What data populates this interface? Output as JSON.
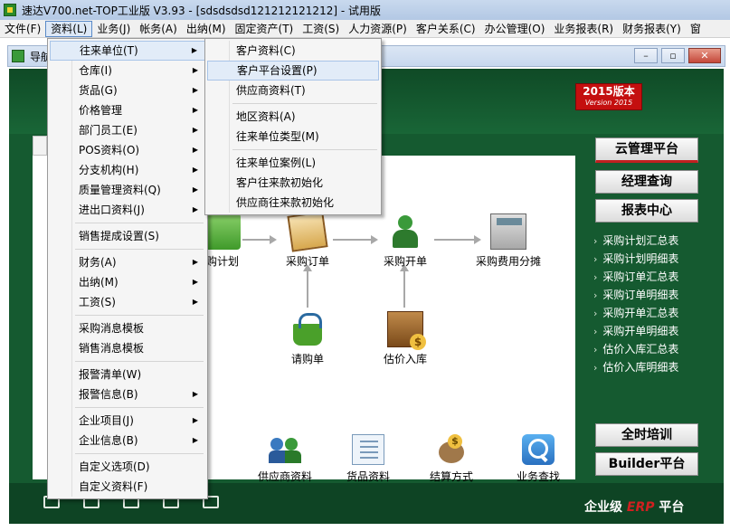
{
  "window": {
    "title": "速达V700.net-TOP工业版 V3.93 - [sdsdsdsd121212121212] - 试用版"
  },
  "menubar": [
    "文件(F)",
    "资料(L)",
    "业务(J)",
    "帐务(A)",
    "出纳(M)",
    "固定资产(T)",
    "工资(S)",
    "人力资源(P)",
    "客户关系(C)",
    "办公管理(O)",
    "业务报表(R)",
    "财务报表(Y)",
    "窗"
  ],
  "inner_window": {
    "title": "导航"
  },
  "version_badge": {
    "main": "2015版本",
    "sub": "Version 2015"
  },
  "menu_main": {
    "items": [
      {
        "label": "往来单位(T)",
        "sub": true
      },
      {
        "label": "仓库(I)",
        "sub": true
      },
      {
        "label": "货品(G)",
        "sub": true
      },
      {
        "label": "价格管理",
        "sub": true
      },
      {
        "label": "部门员工(E)",
        "sub": true
      },
      {
        "label": "POS资料(O)",
        "sub": true
      },
      {
        "label": "分支机构(H)",
        "sub": true
      },
      {
        "label": "质量管理资料(Q)",
        "sub": true
      },
      {
        "label": "进出口资料(J)",
        "sub": true
      },
      {
        "label": "销售提成设置(S)",
        "sub": false
      },
      {
        "label": "财务(A)",
        "sub": true
      },
      {
        "label": "出纳(M)",
        "sub": true
      },
      {
        "label": "工资(S)",
        "sub": true
      },
      {
        "label": "采购消息模板",
        "sub": false
      },
      {
        "label": "销售消息模板",
        "sub": false
      },
      {
        "label": "报警清单(W)",
        "sub": false
      },
      {
        "label": "报警信息(B)",
        "sub": true
      },
      {
        "label": "企业项目(J)",
        "sub": true
      },
      {
        "label": "企业信息(B)",
        "sub": true
      },
      {
        "label": "自定义选项(D)",
        "sub": false
      },
      {
        "label": "自定义资料(F)",
        "sub": false
      }
    ]
  },
  "menu_sub": {
    "items": [
      {
        "label": "客户资料(C)"
      },
      {
        "label": "客户平台设置(P)"
      },
      {
        "label": "供应商资料(T)"
      },
      {
        "label": "地区资料(A)"
      },
      {
        "label": "往来单位类型(M)"
      },
      {
        "label": "往来单位案例(L)"
      },
      {
        "label": "客户往来款初始化"
      },
      {
        "label": "供应商往来款初始化"
      }
    ]
  },
  "flow": {
    "purchase_plan": "购计划",
    "purchase_order": "采购订单",
    "purchase_invoice": "采购开单",
    "cost_allocation": "采购费用分摊",
    "requisition": "请购单",
    "estimated_receipt": "估价入库"
  },
  "bottom_items": {
    "customer_info_tail": "料",
    "supplier_info": "供应商资料",
    "goods_info": "货品资料",
    "settlement": "结算方式",
    "business_search": "业务查找"
  },
  "right_panel": {
    "cloud": "云管理平台",
    "manager_query": "经理查询",
    "report_center": "报表中心",
    "training": "全时培训",
    "builder": "Builder平台",
    "reports": [
      "采购计划汇总表",
      "采购计划明细表",
      "采购订单汇总表",
      "采购订单明细表",
      "采购开单汇总表",
      "采购开单明细表",
      "估价入库汇总表",
      "估价入库明细表"
    ]
  },
  "footer": {
    "prefix": "企业级",
    "erp": "ERP",
    "suffix": "平台"
  }
}
